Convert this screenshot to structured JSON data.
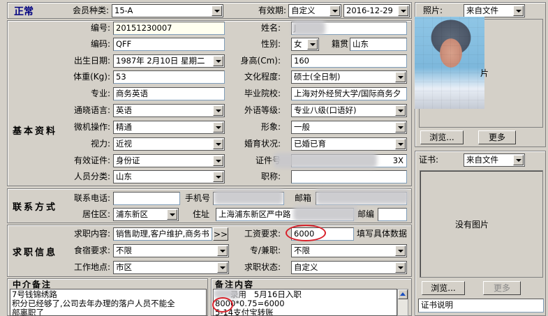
{
  "header": {
    "status_title": "正常",
    "member_type_label": "会员种类:",
    "member_type_value": "15-A",
    "validity_label": "有效期:",
    "validity_type": "自定义",
    "validity_date": "2016-12-29"
  },
  "photo": {
    "label": "照片:",
    "source": "来自文件",
    "overlay_char": "片",
    "browse_button": "浏览...",
    "more_button": "更多"
  },
  "certificate": {
    "label": "证书:",
    "source": "来自文件",
    "empty_text": "没有图片",
    "browse_button": "浏览...",
    "more_button": "更多",
    "description": "证书说明"
  },
  "basic_info": {
    "section_title": "基本资料",
    "number_label": "编号:",
    "number_value": "20151230007",
    "code_label": "编码:",
    "code_value": "QFF",
    "birthday_label": "出生日期:",
    "birthday_value": "1987年 2月10日 星期二",
    "weight_label": "体重(Kg):",
    "weight_value": "53",
    "major_label": "专业:",
    "major_value": "商务英语",
    "language_label": "通晓语言:",
    "language_value": "英语",
    "computer_label": "微机操作:",
    "computer_value": "精通",
    "eyesight_label": "视力:",
    "eyesight_value": "近视",
    "id_type_label": "有效证件:",
    "id_type_value": "身份证",
    "category_label": "人员分类:",
    "category_value": "山东",
    "name_label": "姓名:",
    "name_value": "J",
    "gender_label": "性别:",
    "gender_value": "女",
    "native_label": "籍贯",
    "native_value": "山东",
    "height_label": "身高(Cm):",
    "height_value": "160",
    "education_label": "文化程度:",
    "education_value": "硕士(全日制)",
    "school_label": "毕业院校:",
    "school_value": "上海对外经贸大学/国际商务夕",
    "foreign_level_label": "外语等级:",
    "foreign_level_value": "专业八级(口语好)",
    "image_label": "形象:",
    "image_value": "一般",
    "marital_label": "婚育状况:",
    "marital_value": "已婚已育",
    "id_no_label": "证件号",
    "id_no_value": "3X",
    "title_label": "职称:",
    "title_value": ""
  },
  "contact": {
    "section_title": "联系方式",
    "phone_label": "联系电话:",
    "phone_value": "",
    "mobile_label": "手机号",
    "email_label": "邮箱",
    "district_label": "居住区:",
    "district_value": "浦东新区",
    "address_label": "住址",
    "address_value": "上海浦东新区严中路",
    "zip_label": "邮编",
    "zip_value": ""
  },
  "job": {
    "section_title": "求职信息",
    "request_label": "求职内容:",
    "request_value": "销售助理,客户维护,商务书",
    "more_btn": ">>",
    "salary_label": "工资要求:",
    "salary_value": "6000",
    "salary_hint": "填写具体数据",
    "meal_label": "食宿要求:",
    "meal_value": "不限",
    "fulltime_label": "专/兼职:",
    "fulltime_value": "不限",
    "location_label": "工作地点:",
    "location_value": "市区",
    "status_label": "求职状态:",
    "status_value": "自定义"
  },
  "notes": {
    "agency_title": "中介备注",
    "agency_lines": [
      "7号钱锦绣路",
      "积分已经够了,公司去年办理的落户人员不能全",
      "部离职了"
    ],
    "remark_title": "备注内容",
    "remark_lines": [
      "      录用   5月16日入职",
      "8000*0.75=6000",
      "5-14支付宝转账"
    ]
  }
}
